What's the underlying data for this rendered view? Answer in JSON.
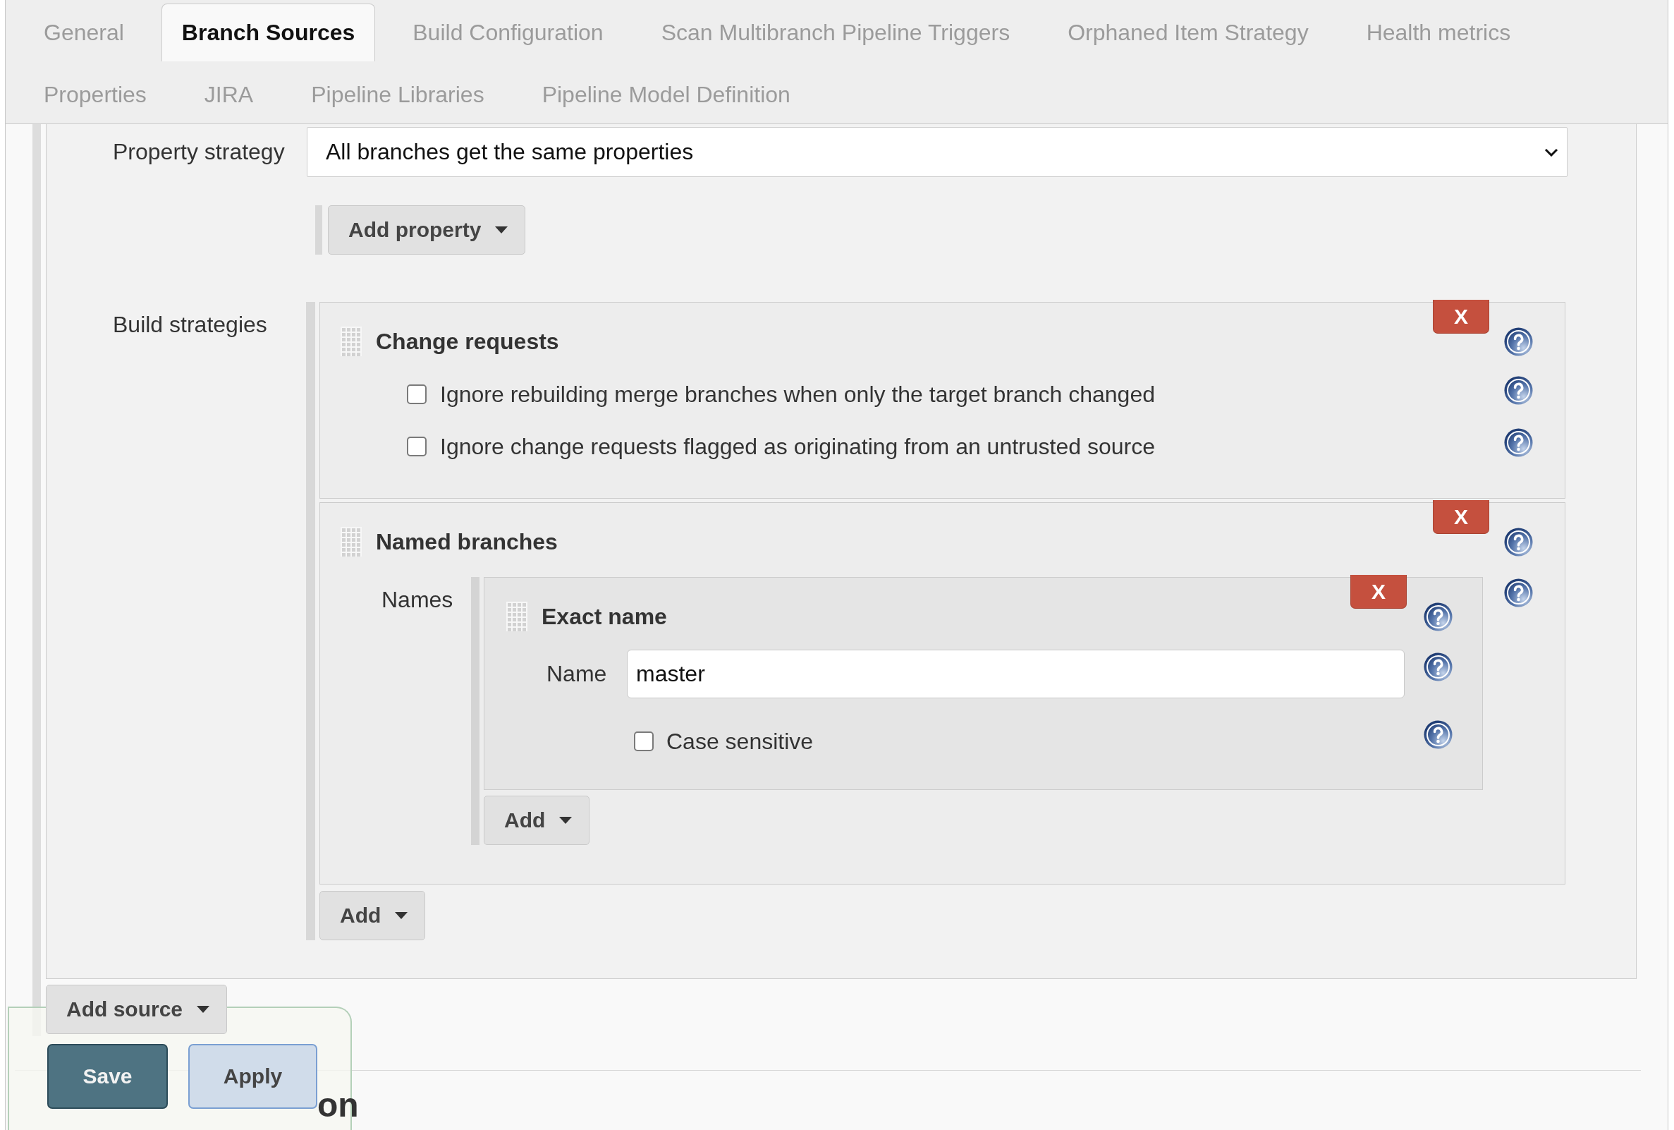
{
  "tabs": [
    {
      "label": "General",
      "selected": false
    },
    {
      "label": "Branch Sources",
      "selected": true
    },
    {
      "label": "Build Configuration",
      "selected": false
    },
    {
      "label": "Scan Multibranch Pipeline Triggers",
      "selected": false
    },
    {
      "label": "Orphaned Item Strategy",
      "selected": false
    },
    {
      "label": "Health metrics",
      "selected": false
    },
    {
      "label": "Properties",
      "selected": false
    },
    {
      "label": "JIRA",
      "selected": false
    },
    {
      "label": "Pipeline Libraries",
      "selected": false
    },
    {
      "label": "Pipeline Model Definition",
      "selected": false
    }
  ],
  "source": {
    "property_strategy": {
      "label": "Property strategy",
      "value": "All branches get the same properties",
      "add_button": "Add property"
    },
    "build_strategies": {
      "label": "Build strategies",
      "items": [
        {
          "kind": "options",
          "title": "Change requests",
          "delete_label": "X",
          "options": [
            {
              "label": "Ignore rebuilding merge branches when only the target branch changed",
              "checked": false
            },
            {
              "label": "Ignore change requests flagged as originating from an untrusted source",
              "checked": false
            }
          ]
        },
        {
          "kind": "names",
          "title": "Named branches",
          "delete_label": "X",
          "names_label": "Names",
          "names": [
            {
              "title": "Exact name",
              "delete_label": "X",
              "fields": [
                {
                  "kind": "text",
                  "label": "Name",
                  "value": "master"
                },
                {
                  "kind": "checkbox",
                  "label": "Case sensitive",
                  "checked": false
                }
              ]
            }
          ],
          "add_button": "Add"
        }
      ],
      "add_button": "Add"
    }
  },
  "add_source_button": "Add source",
  "section_heading": "on",
  "buttons": [
    {
      "kind": "primary",
      "label": "Save"
    },
    {
      "kind": "secondary",
      "label": "Apply"
    }
  ]
}
